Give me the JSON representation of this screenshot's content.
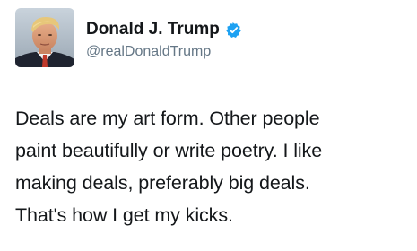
{
  "user": {
    "display_name": "Donald J. Trump",
    "handle": "@realDonaldTrump",
    "verified": true,
    "verified_icon": "verified-badge-icon",
    "avatar_icon": "profile-photo"
  },
  "tweet": {
    "lines": [
      "Deals are my art form. Other people",
      "paint beautifully or write poetry. I like",
      "making deals, preferably big deals.",
      "That's how I get my kicks."
    ]
  },
  "colors": {
    "text": "#14171a",
    "handle": "#657786",
    "verified": "#1da1f2",
    "background": "#ffffff"
  }
}
